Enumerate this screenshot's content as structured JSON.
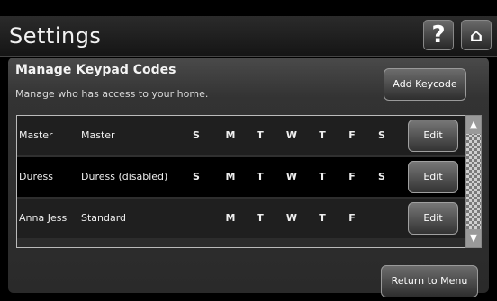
{
  "header": {
    "title": "Settings",
    "help_glyph": "?",
    "home_glyph": "⌂"
  },
  "panel": {
    "heading": "Manage Keypad Codes",
    "subtitle": "Manage who has access to your home.",
    "add_button_label": "Add Keycode",
    "return_button_label": "Return to Menu"
  },
  "rows": [
    {
      "name": "Master",
      "type": "Master",
      "days": [
        "S",
        "M",
        "T",
        "W",
        "T",
        "F",
        "S"
      ],
      "edit_label": "Edit"
    },
    {
      "name": "Duress",
      "type": "Duress (disabled)",
      "days": [
        "S",
        "M",
        "T",
        "W",
        "T",
        "F",
        "S"
      ],
      "edit_label": "Edit"
    },
    {
      "name": "Anna Jess",
      "type": "Standard",
      "days": [
        "",
        "M",
        "T",
        "W",
        "T",
        "F",
        ""
      ],
      "edit_label": "Edit"
    }
  ],
  "scrollbar": {
    "up_glyph": "▲",
    "down_glyph": "▼"
  },
  "icons": {
    "help": "help-icon",
    "home": "home-icon"
  },
  "colors": {
    "background": "#000000",
    "panel": "#333333",
    "button": "#4a4a4a"
  }
}
